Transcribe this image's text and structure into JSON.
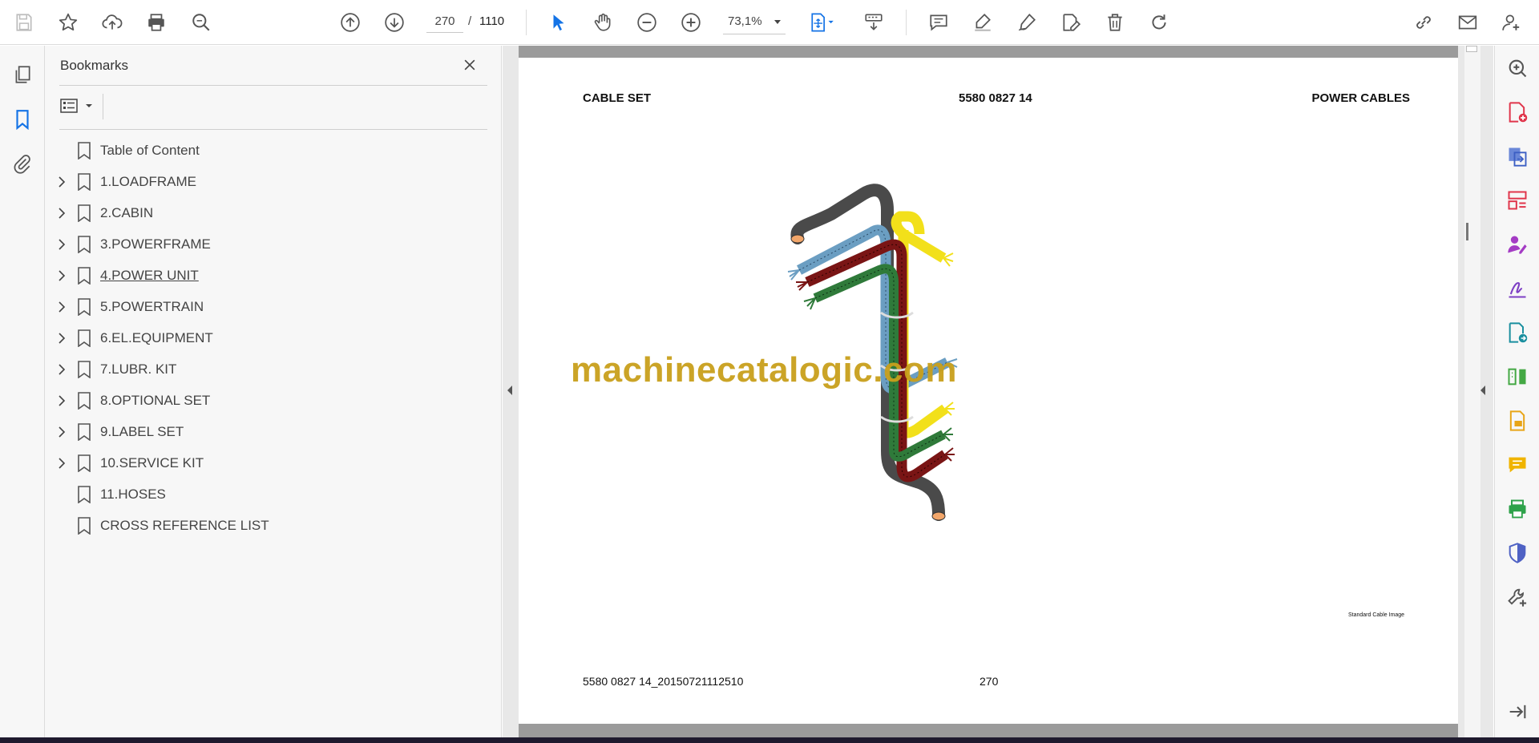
{
  "toolbar": {
    "page_current": "270",
    "page_separator": "/",
    "page_total": "1110",
    "zoom": "73,1%",
    "icons": [
      "save-icon",
      "star-icon",
      "upload-icon",
      "print-icon",
      "search-icon",
      "prev-page-icon",
      "next-page-icon",
      "zoom-out-icon",
      "zoom-in-icon",
      "select-icon",
      "hand-icon",
      "fit-page-icon",
      "scroll-mode-icon",
      "comment-icon",
      "highlight-icon",
      "draw-icon",
      "edit-icon",
      "delete-icon",
      "rotate-icon",
      "share-link-icon",
      "email-icon",
      "user-icon"
    ]
  },
  "bookmarks": {
    "title": "Bookmarks",
    "items": [
      {
        "label": "Table of Content",
        "expandable": false
      },
      {
        "label": "1.LOADFRAME",
        "expandable": true
      },
      {
        "label": "2.CABIN",
        "expandable": true
      },
      {
        "label": "3.POWERFRAME",
        "expandable": true
      },
      {
        "label": "4.POWER UNIT",
        "expandable": true
      },
      {
        "label": "5.POWERTRAIN",
        "expandable": true
      },
      {
        "label": "6.EL.EQUIPMENT",
        "expandable": true
      },
      {
        "label": "7.LUBR. KIT",
        "expandable": true
      },
      {
        "label": "8.OPTIONAL SET",
        "expandable": true
      },
      {
        "label": "9.LABEL SET",
        "expandable": true
      },
      {
        "label": "10.SERVICE KIT",
        "expandable": true
      },
      {
        "label": "11.HOSES",
        "expandable": false
      },
      {
        "label": "CROSS REFERENCE LIST",
        "expandable": false
      }
    ]
  },
  "document": {
    "header_left": "CABLE SET",
    "header_center": "5580 0827 14",
    "header_right": "POWER CABLES",
    "watermark": "machinecatalogic.com",
    "image_caption": "Standard Cable Image",
    "footer_left": "5580 0827 14_20150721112510",
    "footer_page": "270"
  },
  "colors": {
    "accent": "#1473e6",
    "watermark": "#c9a01c",
    "cable_black": "#4a4a4a",
    "cable_blue": "#6b9ec2",
    "cable_yellow": "#f2e01a",
    "cable_red": "#7a1515",
    "cable_green": "#2f7a3a"
  }
}
